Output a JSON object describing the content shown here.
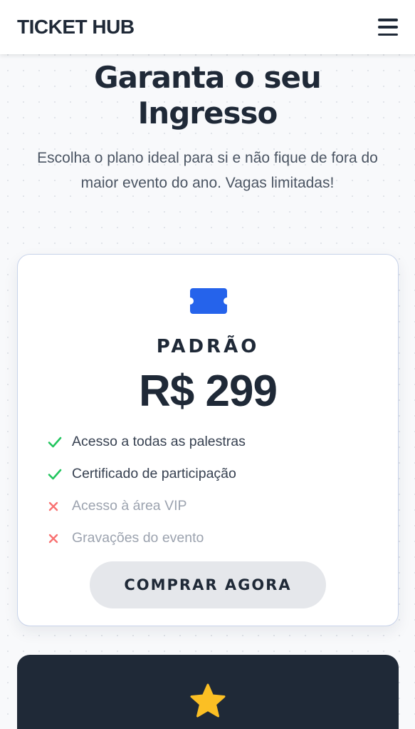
{
  "header": {
    "brand": "TICKET HUB",
    "menu_icon": "hamburger-menu-icon"
  },
  "hero": {
    "title": "Garanta o seu Ingresso",
    "subtitle": "Escolha o plano ideal para si e não fique de fora do maior evento do ano. Vagas limitadas!"
  },
  "plans": [
    {
      "icon": "ticket-icon",
      "name": "PADRÃO",
      "price": "R$ 299",
      "features": [
        {
          "label": "Acesso a todas as palestras",
          "included": true
        },
        {
          "label": "Certificado de participação",
          "included": true
        },
        {
          "label": "Acesso à área VIP",
          "included": false
        },
        {
          "label": "Gravações do evento",
          "included": false
        }
      ],
      "button_label": "COMPRAR AGORA"
    },
    {
      "icon": "star-icon"
    }
  ],
  "colors": {
    "accent_blue": "#2563eb",
    "check_green": "#22c55e",
    "cross_red": "#f87171",
    "dark_card": "#1f2937",
    "star_yellow": "#fbbf24"
  }
}
